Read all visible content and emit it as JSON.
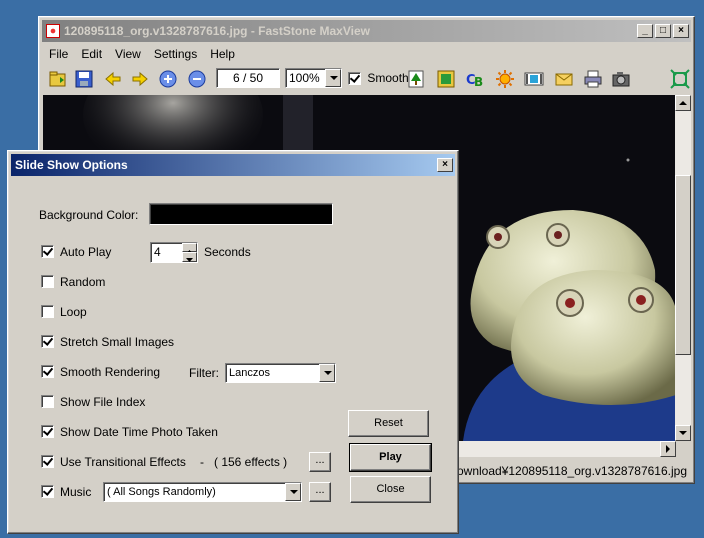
{
  "main_window": {
    "title": "120895118_org.v1328787616.jpg - FastStone MaxView",
    "menu": [
      "File",
      "Edit",
      "View",
      "Settings",
      "Help"
    ],
    "page_counter": "6 / 50",
    "zoom": "100%",
    "smooth_label": "Smooth",
    "smooth_checked": true,
    "status_path": "#@Download¥120895118_org.v1328787616.jpg"
  },
  "dialog": {
    "title": "Slide Show Options",
    "background_color_label": "Background Color:",
    "background_color": "#000000",
    "options": {
      "auto_play": {
        "label": "Auto Play",
        "checked": true
      },
      "seconds_value": "4",
      "seconds_label": "Seconds",
      "random": {
        "label": "Random",
        "checked": false
      },
      "loop": {
        "label": "Loop",
        "checked": false
      },
      "stretch": {
        "label": "Stretch Small Images",
        "checked": true
      },
      "smooth_rendering": {
        "label": "Smooth Rendering",
        "checked": true
      },
      "filter_label": "Filter:",
      "filter_value": "Lanczos",
      "show_file_index": {
        "label": "Show File Index",
        "checked": false
      },
      "show_date": {
        "label": "Show Date Time Photo Taken",
        "checked": true
      },
      "transitional": {
        "label": "Use Transitional Effects",
        "checked": true
      },
      "effects_count": "-   ( 156 effects )",
      "music": {
        "label": "Music",
        "checked": true
      },
      "music_value": "( All Songs Randomly)"
    },
    "buttons": {
      "reset": "Reset",
      "play": "Play",
      "close": "Close",
      "browse": "..."
    }
  },
  "icons": {
    "open": "folder-open-icon",
    "save": "save-icon",
    "prev": "arrow-left-icon",
    "next": "arrow-right-icon",
    "zoom_in": "zoom-in-icon",
    "zoom_out": "zoom-out-icon",
    "slideshow": "slideshow-icon",
    "fullscreen": "fullscreen-icon"
  },
  "colors": {
    "title_active": "#0a246a",
    "title_inactive": "#808080",
    "desktop": "#3a6ea5",
    "face": "#d4d0c8"
  }
}
